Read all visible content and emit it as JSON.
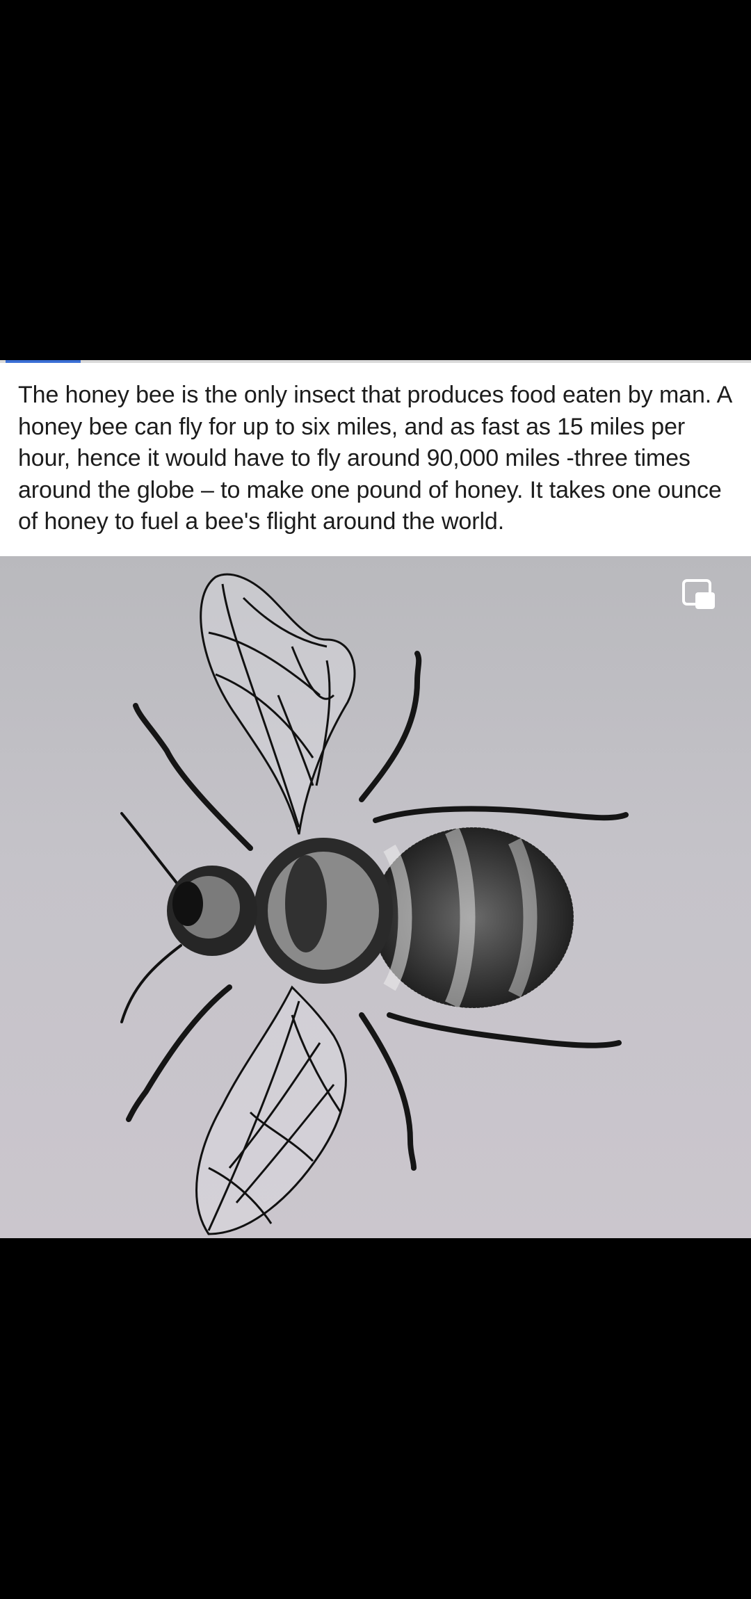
{
  "media_player": {
    "progress_fraction": 0.1,
    "progress_color": "#3b6fd6"
  },
  "post": {
    "caption": "The honey bee is the only insect that produces food eaten by man. A honey bee can fly for up to six miles, and as fast as 15 miles per hour, hence it would have to fly around 90,000 miles -three times around the globe – to make one pound of honey. It takes one ounce of honey to fuel a bee's flight around the world."
  },
  "image": {
    "subject": "bee-illustration",
    "pip_icon": "picture-in-picture-icon"
  }
}
